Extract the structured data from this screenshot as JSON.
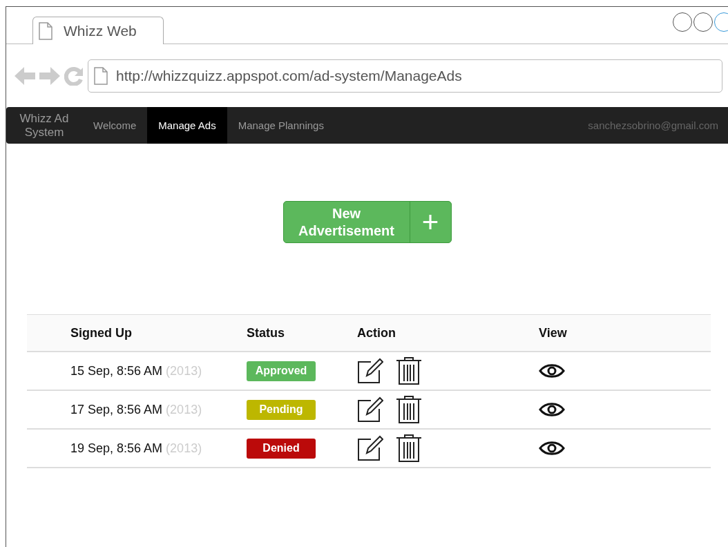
{
  "browser": {
    "tab_title": "Whizz Web",
    "url": "http://whizzquizz.appspot.com/ad-system/ManageAds"
  },
  "navbar": {
    "brand": "Whizz Ad System",
    "items": [
      {
        "label": "Welcome",
        "selected": false
      },
      {
        "label": "Manage Ads",
        "selected": true
      },
      {
        "label": "Manage Plannings",
        "selected": false
      }
    ],
    "user_email": "sanchezsobrino@gmail.com"
  },
  "new_button": {
    "label": "New Advertisement",
    "icon_glyph": "+"
  },
  "table": {
    "columns": [
      "Signed Up",
      "Status",
      "Action",
      "View"
    ],
    "rows": [
      {
        "date": "15 Sep, 8:56 AM",
        "year": "(2013)",
        "status": "Approved",
        "color": "#5cb85c"
      },
      {
        "date": "17 Sep, 8:56 AM",
        "year": "(2013)",
        "status": "Pending",
        "color": "#bdb700"
      },
      {
        "date": "19 Sep, 8:56 AM",
        "year": "(2013)",
        "status": "Denied",
        "color": "#bb0a0a"
      }
    ]
  }
}
